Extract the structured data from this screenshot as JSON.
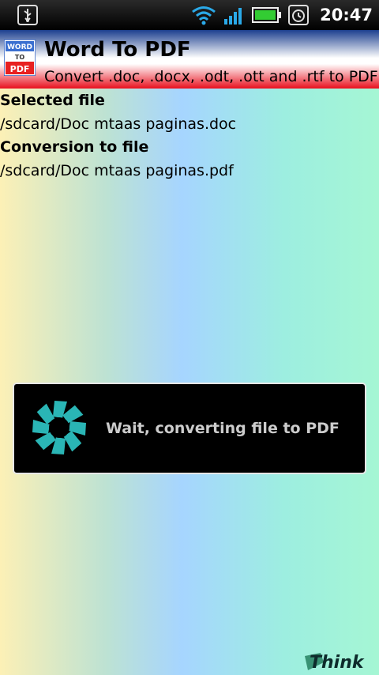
{
  "status_bar": {
    "time": "20:47",
    "icons": [
      "usb-icon",
      "wifi-icon",
      "signal-icon",
      "battery-icon",
      "alarm-icon"
    ]
  },
  "app": {
    "icon_text": [
      "WORD",
      "TO",
      "PDF"
    ],
    "title": "Word To PDF",
    "subtitle": "Convert .doc, .docx, .odt, .ott and .rtf to PDF"
  },
  "main": {
    "selected_label": "Selected file",
    "selected_path": "/sdcard/Doc mtaas paginas.doc",
    "conversion_label": "Conversion to file",
    "conversion_path": "/sdcard/Doc mtaas paginas.pdf"
  },
  "dialog": {
    "message": "Wait, converting file to PDF"
  },
  "footer": {
    "logo_text": "Think"
  },
  "colors": {
    "title_gradient": [
      "#1c3f8f",
      "#ffffff",
      "#e8101e"
    ],
    "battery": "#33cc33",
    "spinner": "#2ab5b5"
  }
}
